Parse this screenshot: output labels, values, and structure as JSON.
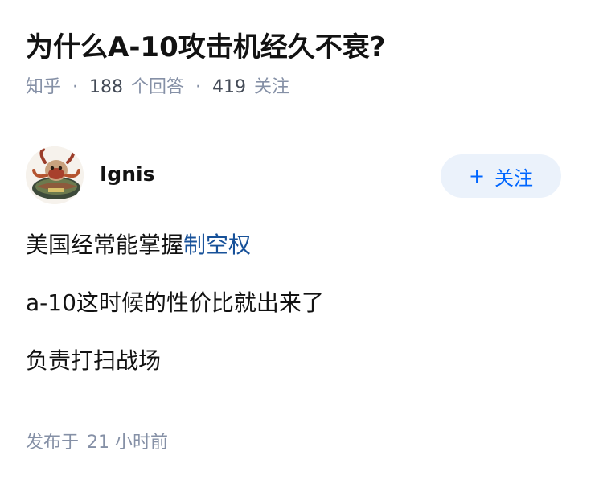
{
  "question": {
    "title": "为什么A-10攻击机经久不衰?",
    "source": "知乎",
    "answer_count": "188",
    "answer_count_label": "个回答",
    "follower_count": "419",
    "follower_label": "关注"
  },
  "author": {
    "name": "Ignis",
    "follow_button_label": "关注",
    "follow_icon": "plus-icon"
  },
  "answer": {
    "line1_prefix": "美国经常能掌握",
    "line1_link": "制空权",
    "line2": "a-10这时候的性价比就出来了",
    "line3": "负责打扫战场"
  },
  "footer": {
    "published_prefix": "发布于",
    "published_time": "21 小时前"
  },
  "colors": {
    "link": "#175199",
    "accent": "#0066ff",
    "follow_bg": "#ebf2fb",
    "meta": "#8590a6"
  }
}
